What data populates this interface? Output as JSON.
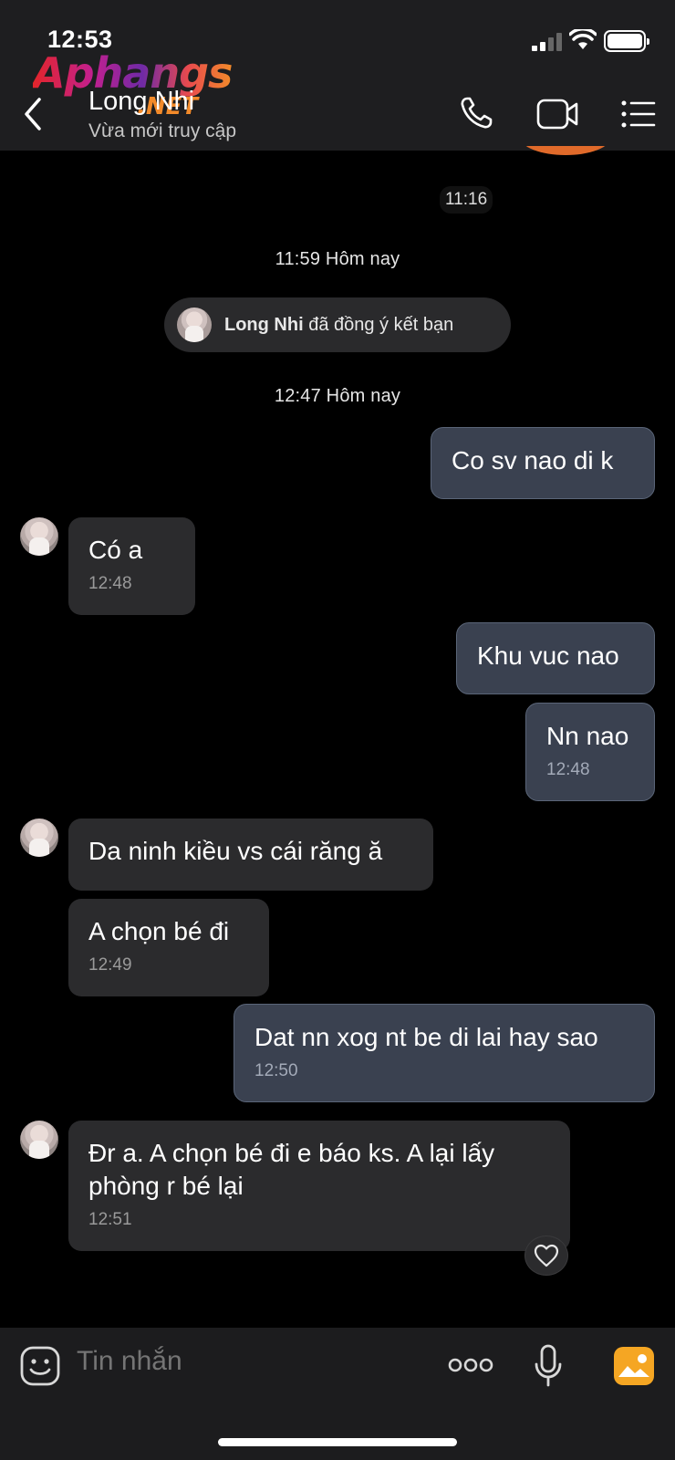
{
  "status_bar": {
    "time": "12:53"
  },
  "watermark": {
    "main": "Aphangs",
    "suffix": ".NET"
  },
  "header": {
    "contact_name": "Long Nhi",
    "status": "Vừa mới truy cập"
  },
  "chat": {
    "time_pill": "11:16",
    "divider_1": "11:59 Hôm nay",
    "friend_notice": {
      "name": "Long Nhi",
      "text": " đã đồng ý kết bạn"
    },
    "divider_2": "12:47 Hôm nay",
    "messages": [
      {
        "dir": "out",
        "text": "Co sv nao di k",
        "time": ""
      },
      {
        "dir": "in",
        "text": "Có a",
        "time": "12:48"
      },
      {
        "dir": "out",
        "text": "Khu vuc nao",
        "time": ""
      },
      {
        "dir": "out",
        "text": "Nn nao",
        "time": "12:48"
      },
      {
        "dir": "in",
        "text": "Da ninh kiều vs cái răng ă",
        "time": ""
      },
      {
        "dir": "in",
        "text": "A chọn bé đi",
        "time": "12:49"
      },
      {
        "dir": "out",
        "text": "Dat nn xog nt be di lai hay sao",
        "time": "12:50"
      },
      {
        "dir": "in",
        "text": "Đr a. A chọn bé đi e báo ks. A lại lấy phòng r bé lại",
        "time": "12:51"
      }
    ]
  },
  "input_bar": {
    "placeholder": "Tin nhắn"
  },
  "colors": {
    "accent_orange": "#f5a623",
    "outgoing_bubble": "#3a4150",
    "incoming_bubble": "#2b2b2d"
  }
}
